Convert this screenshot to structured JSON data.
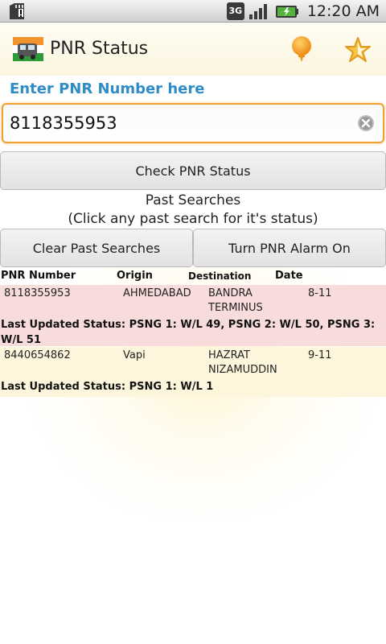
{
  "statusbar": {
    "network": "3G",
    "time": "12:20 AM"
  },
  "titlebar": {
    "title": "PNR Status",
    "icons": [
      "train-app-icon",
      "bulb-icon",
      "star-icon"
    ]
  },
  "form": {
    "label": "Enter PNR Number here",
    "pnr_value": "8118355953",
    "check_button": "Check PNR Status"
  },
  "past": {
    "title": "Past Searches",
    "subtitle": "(Click any past search for it's status)",
    "clear_button": "Clear Past Searches",
    "alarm_button": "Turn PNR Alarm On"
  },
  "table": {
    "headers": {
      "pnr": "PNR Number",
      "origin": "Origin",
      "destination": "Destination",
      "date": "Date"
    },
    "rows": [
      {
        "pnr": "8118355953",
        "origin": "AHMEDABAD",
        "destination_line1": "BANDRA",
        "destination_line2": "TERMINUS",
        "date": "8-11",
        "status": "Last Updated Status: PSNG 1: W/L 49, PSNG 2: W/L 50, PSNG 3: W/L 51"
      },
      {
        "pnr": "8440654862",
        "origin": "Vapi",
        "destination_line1": "HAZRAT",
        "destination_line2": "NIZAMUDDIN",
        "date": "9-11",
        "status": "Last Updated Status: PSNG 1: W/L 1"
      }
    ]
  },
  "colors": {
    "label_blue": "#2f8cc6",
    "input_focus": "#f0a030",
    "row1_bg": "#f8dcdc",
    "row2_bg": "#fdf6dc"
  }
}
